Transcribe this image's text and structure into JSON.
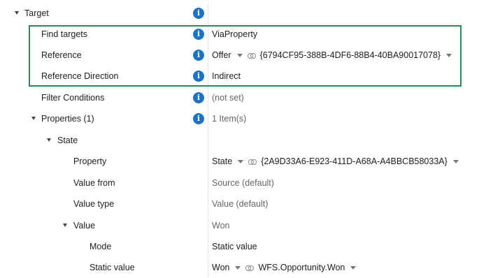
{
  "rows": [
    {
      "label": "Target",
      "info": true,
      "value": ""
    },
    {
      "label": "Find targets",
      "info": true,
      "value": "ViaProperty"
    },
    {
      "label": "Reference",
      "info": true,
      "value_main": "Offer",
      "value_id": "{6794CF95-388B-4DF6-88B4-40BA90017078}"
    },
    {
      "label": "Reference Direction",
      "info": true,
      "value": "Indirect"
    },
    {
      "label": "Filter Conditions",
      "info": true,
      "value": "(not set)"
    },
    {
      "label": "Properties (1)",
      "info": true,
      "value": "1 Item(s)"
    },
    {
      "label": "State",
      "value": ""
    },
    {
      "label": "Property",
      "value_main": "State",
      "value_id": "{2A9D33A6-E923-411D-A68A-A4BBCB58033A}"
    },
    {
      "label": "Value from",
      "value": "Source (default)"
    },
    {
      "label": "Value type",
      "value": "Value (default)"
    },
    {
      "label": "Value",
      "value": "Won"
    },
    {
      "label": "Mode",
      "value": "Static value"
    },
    {
      "label": "Static value",
      "value_main": "Won",
      "value_id": "WFS.Opportunity.Won"
    }
  ],
  "icons": {
    "info": "info-icon",
    "expand": "expand-triangle-icon",
    "dropdown": "dropdown-arrow-icon",
    "link": "link-icon"
  },
  "colors": {
    "info": "#1a73c8",
    "highlight": "#2a8a57",
    "muted": "#666666"
  }
}
